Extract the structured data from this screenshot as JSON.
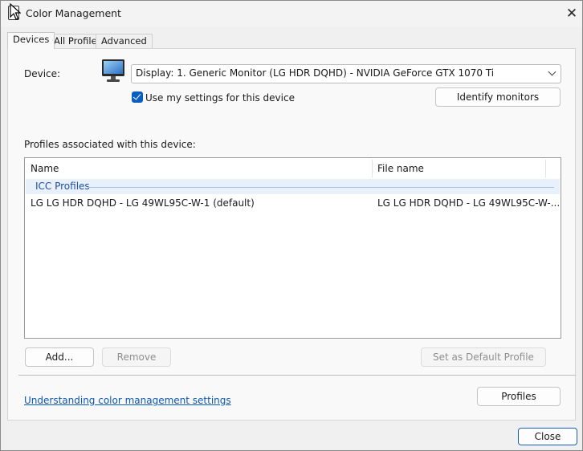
{
  "window": {
    "title": "Color Management",
    "close_glyph": "✕"
  },
  "tabs": [
    {
      "label": "Devices",
      "active": true
    },
    {
      "label": "All Profiles",
      "active": false
    },
    {
      "label": "Advanced",
      "active": false
    }
  ],
  "device": {
    "label": "Device:",
    "selected": "Display: 1. Generic Monitor (LG HDR DQHD) - NVIDIA GeForce GTX 1070 Ti",
    "use_my_settings_label": "Use my settings for this device",
    "use_my_settings_checked": true,
    "identify_button": "Identify monitors"
  },
  "profiles": {
    "section_label": "Profiles associated with this device:",
    "columns": [
      "Name",
      "File name"
    ],
    "group": "ICC Profiles",
    "rows": [
      {
        "name": "LG LG HDR DQHD - LG 49WL95C-W-1 (default)",
        "file": "LG LG HDR DQHD - LG 49WL95C-W-..."
      }
    ]
  },
  "buttons": {
    "add": "Add...",
    "remove": "Remove",
    "set_default": "Set as Default Profile",
    "profiles": "Profiles",
    "close": "Close"
  },
  "link": {
    "text": "Understanding color management settings"
  },
  "colors": {
    "accent": "#0a5ec2",
    "link": "#0b57b3",
    "group_text": "#1d4e9a"
  },
  "icons": {
    "window": "color-management-icon",
    "device": "monitor-icon",
    "close": "close-icon",
    "dropdown": "chevron-down-icon",
    "check": "checkmark-icon"
  }
}
